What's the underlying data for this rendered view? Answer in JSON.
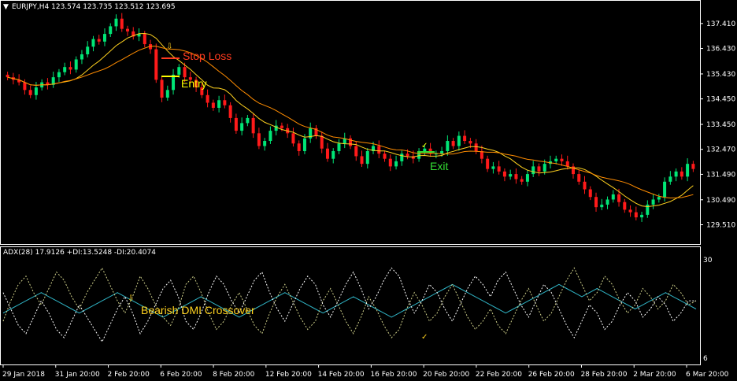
{
  "header": {
    "main_title": "EURJPY,H4  123.574 123.735 123.512 123.695",
    "sub_title": "ADX(28) 17.9126 +DI:13.5248 -DI:20.4074"
  },
  "annotations": {
    "stop_loss": "Stop Loss",
    "entry": "Entry",
    "exit": "Exit",
    "crossover": "Bearish DMI Crossover"
  },
  "colors": {
    "background": "#000000",
    "bull_candle": "#00e676",
    "bear_candle": "#ff1a1a",
    "ma_fast": "#ffd21f",
    "ma_slow": "#ff8c00",
    "adx": "#2fb3c4",
    "plus_di": "#cfd08a",
    "minus_di": "#ffffff",
    "stop_loss": "#ff3b1f",
    "entry": "#ffff00",
    "exit": "#33dd33",
    "grid_text": "#ffffff"
  },
  "icons": {
    "entry_arrow": "down-arrow-icon",
    "exit_mark": "checkmark-icon"
  },
  "chart_data": [
    {
      "type": "candlestick",
      "symbol": "EURJPY",
      "timeframe": "H4",
      "ylim": [
        129.0,
        137.9
      ],
      "y_ticks": [
        "137.410",
        "136.430",
        "135.430",
        "134.450",
        "133.450",
        "132.470",
        "131.490",
        "130.490",
        "129.510"
      ],
      "x_ticks": [
        "29 Jan 2018",
        "31 Jan 20:00",
        "2 Feb 20:00",
        "6 Feb 20:00",
        "8 Feb 20:00",
        "12 Feb 20:00",
        "14 Feb 20:00",
        "16 Feb 20:00",
        "20 Feb 20:00",
        "22 Feb 20:00",
        "26 Feb 20:00",
        "28 Feb 20:00",
        "2 Mar 20:00",
        "6 Mar 20:00"
      ],
      "close": [
        135.3,
        135.2,
        135.1,
        134.8,
        134.6,
        134.9,
        135.1,
        135.0,
        135.3,
        135.5,
        135.7,
        135.6,
        136.0,
        136.2,
        136.5,
        136.8,
        136.7,
        137.0,
        137.3,
        137.6,
        137.2,
        137.1,
        136.9,
        137.0,
        136.6,
        136.4,
        135.2,
        134.5,
        134.8,
        135.4,
        135.7,
        135.3,
        135.2,
        134.9,
        134.6,
        134.3,
        134.1,
        134.4,
        134.2,
        133.7,
        133.2,
        133.5,
        133.7,
        133.1,
        132.6,
        132.8,
        133.2,
        133.4,
        133.3,
        133.1,
        132.7,
        132.4,
        132.9,
        133.3,
        133.0,
        132.5,
        132.1,
        132.4,
        132.7,
        132.9,
        132.6,
        132.2,
        131.9,
        132.4,
        132.6,
        132.3,
        132.1,
        131.8,
        132.0,
        132.3,
        132.2,
        132.1,
        132.4,
        132.5,
        132.3,
        132.3,
        132.4,
        132.8,
        132.6,
        133.0,
        132.8,
        132.7,
        132.4,
        132.1,
        131.7,
        131.8,
        131.6,
        131.4,
        131.5,
        131.3,
        131.2,
        131.5,
        131.8,
        131.6,
        131.9,
        132.0,
        132.1,
        132.0,
        131.8,
        131.5,
        131.2,
        130.9,
        130.6,
        130.2,
        130.3,
        130.5,
        130.7,
        130.4,
        130.1,
        130.0,
        129.8,
        129.9,
        130.3,
        130.5,
        130.6,
        131.2,
        131.4,
        131.6,
        131.4,
        131.9,
        131.7
      ],
      "moving_averages": [
        "fast",
        "slow"
      ]
    },
    {
      "type": "line",
      "indicator": "ADX(28)",
      "values_label": "17.9126 +DI:13.5248 -DI:20.4074",
      "ylim": [
        6,
        30
      ],
      "y_ticks": [
        "30",
        "6"
      ],
      "series": [
        {
          "key": "adx",
          "values": [
            17,
            18,
            19,
            20,
            21,
            22,
            21,
            20,
            19,
            18,
            17,
            18,
            19,
            20,
            21,
            22,
            21,
            20,
            19,
            18,
            17,
            16,
            17,
            18,
            19,
            20,
            21,
            20,
            19,
            18,
            17,
            16,
            17,
            18,
            19,
            20,
            21,
            22,
            21,
            20,
            19,
            18,
            17,
            18,
            19,
            20,
            21,
            20,
            19,
            18,
            17,
            16,
            17,
            18,
            19,
            20,
            21,
            22,
            23,
            24,
            23,
            22,
            21,
            20,
            19,
            18,
            17,
            18,
            19,
            20,
            21,
            22,
            23,
            24,
            23,
            22,
            21,
            22,
            23,
            22,
            21,
            20,
            19,
            18,
            19,
            20,
            21,
            22,
            21,
            20,
            19,
            18
          ]
        },
        {
          "key": "plus_di",
          "values": [
            15,
            20,
            24,
            26,
            22,
            19,
            23,
            27,
            25,
            21,
            18,
            22,
            25,
            28,
            24,
            20,
            17,
            21,
            26,
            23,
            19,
            16,
            14,
            18,
            24,
            26,
            22,
            17,
            13,
            15,
            19,
            22,
            18,
            14,
            12,
            17,
            21,
            24,
            20,
            16,
            13,
            15,
            20,
            23,
            19,
            15,
            12,
            16,
            21,
            18,
            14,
            11,
            13,
            18,
            22,
            19,
            15,
            17,
            21,
            24,
            20,
            16,
            13,
            15,
            18,
            14,
            12,
            16,
            20,
            23,
            19,
            15,
            17,
            21,
            25,
            28,
            24,
            20,
            22,
            26,
            24,
            20,
            17,
            19,
            23,
            21,
            18,
            20,
            24,
            22,
            19,
            20
          ]
        },
        {
          "key": "minus_di",
          "values": [
            22,
            18,
            14,
            12,
            16,
            20,
            17,
            13,
            11,
            15,
            19,
            16,
            13,
            10,
            14,
            18,
            21,
            17,
            12,
            15,
            19,
            23,
            25,
            21,
            15,
            13,
            17,
            22,
            26,
            24,
            20,
            17,
            21,
            25,
            27,
            22,
            18,
            15,
            19,
            23,
            26,
            24,
            19,
            16,
            20,
            24,
            27,
            23,
            18,
            21,
            25,
            28,
            26,
            21,
            17,
            20,
            24,
            22,
            18,
            15,
            19,
            23,
            26,
            24,
            21,
            25,
            27,
            23,
            19,
            16,
            20,
            24,
            22,
            18,
            14,
            11,
            15,
            19,
            17,
            13,
            15,
            19,
            22,
            20,
            16,
            18,
            21,
            19,
            15,
            17,
            20,
            20
          ]
        }
      ]
    }
  ]
}
